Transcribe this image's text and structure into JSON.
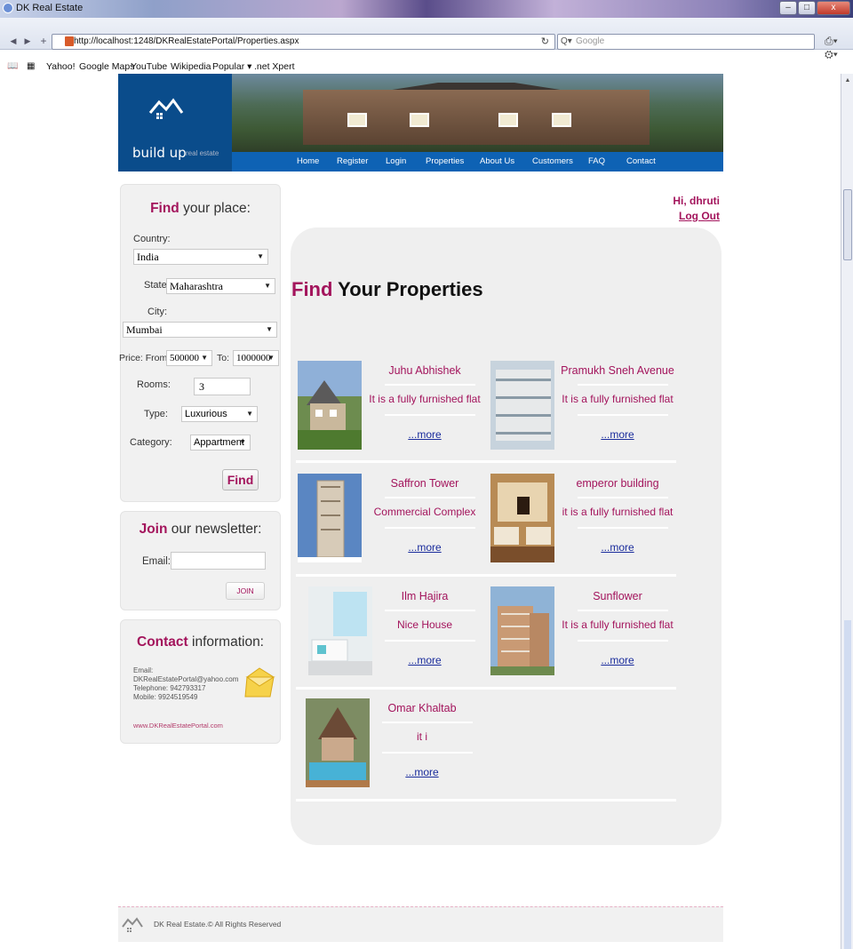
{
  "browser": {
    "window_title": "DK Real Estate",
    "url": "http://localhost:1248/DKRealEstatePortal/Properties.aspx",
    "search_placeholder": "Google",
    "bookmarks": [
      "Yahoo!",
      "Google Maps",
      "YouTube",
      "Wikipedia",
      "Popular ▾",
      ".net Xpert"
    ]
  },
  "header": {
    "brand": "build up",
    "brand_sub": "real estate",
    "menu": [
      "Home",
      "Register",
      "Login",
      "Properties",
      "About Us",
      "Customers",
      "FAQ",
      "Contact"
    ]
  },
  "search_box": {
    "title_bold": "Find",
    "title_rest": " your place:",
    "country_label": "Country:",
    "country_value": "India",
    "state_label": "State:",
    "state_value": "Maharashtra",
    "city_label": "City:",
    "city_value": "Mumbai",
    "price_label": "Price: From:",
    "price_from": "500000",
    "price_to_label": "To:",
    "price_to": "1000000",
    "rooms_label": "Rooms:",
    "rooms_value": "3",
    "type_label": "Type:",
    "type_value": "Luxurious",
    "category_label": "Category:",
    "category_value": "Appartment",
    "find_button": "Find"
  },
  "newsletter": {
    "title_bold": "Join",
    "title_rest": " our newsletter:",
    "email_label": "Email:",
    "email_value": "",
    "join_button": "JOIN"
  },
  "contact": {
    "title_bold": "Contact",
    "title_rest": " information:",
    "email_label": "Email:",
    "email": "DKRealEstatePortal@yahoo.com",
    "telephone": "Telephone: 942793317",
    "mobile": "Mobile: 9924519549",
    "website": "www.DKRealEstatePortal.com"
  },
  "user": {
    "greeting": "Hi, dhruti",
    "logout": "Log Out"
  },
  "main": {
    "title_bold": "Find",
    "title_rest": " Your Properties",
    "more_label_1": "...more",
    "more_label_2": "...more",
    "properties": [
      {
        "name": "Juhu Abhishek",
        "desc": "It is a fully furnished flat",
        "more": "...more"
      },
      {
        "name": "Pramukh Sneh Avenue",
        "desc": "It is a fully furnished flat",
        "more": "...more"
      },
      {
        "name": "Saffron Tower",
        "desc": "Commercial Complex",
        "more": "...more"
      },
      {
        "name": "emperor building",
        "desc": "it is a fully furnished flat",
        "more": "...more"
      },
      {
        "name": "Ilm Hajira",
        "desc": "Nice House",
        "more": "...more"
      },
      {
        "name": "Sunflower",
        "desc": "It is a fully furnished flat",
        "more": "...more"
      },
      {
        "name": "Omar Khaltab",
        "desc": "it i",
        "more": "...more"
      }
    ]
  },
  "footer": {
    "text": "DK Real Estate.© All Rights Reserved"
  }
}
